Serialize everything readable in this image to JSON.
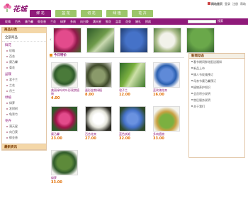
{
  "brand": {
    "logo_text": "花城",
    "accent": "#8f1a7a",
    "tab_green": "#9cc66a",
    "price_color": "#e06c00"
  },
  "top_links": [
    "网站首页",
    "登录",
    "注册",
    "帮助"
  ],
  "tabs": [
    {
      "label": "鲜 花"
    },
    {
      "label": "盆 花"
    },
    {
      "label": "切 花"
    },
    {
      "label": "绿 植"
    },
    {
      "label": "花 卉"
    }
  ],
  "nav": [
    "玫瑰",
    "百合",
    "康乃馨",
    "郁金香",
    "兰花",
    "绿萝",
    "多肉",
    "向日葵",
    "满天星",
    "鲜花",
    "盆栽",
    "花束",
    "婚礼",
    "探病"
  ],
  "search": {
    "button": "搜索"
  },
  "sidebar": {
    "title": "商品分类",
    "all": "全部商品",
    "groups": [
      {
        "name": "鲜花",
        "items": [
          "玫瑰",
          "百合",
          "康乃馨",
          "菊花"
        ]
      },
      {
        "name": "盆栽",
        "items": [
          "君子兰",
          "兰花",
          "吊兰"
        ]
      },
      {
        "name": "绿植",
        "items": [
          "绿萝",
          "发财树",
          "龟背竹"
        ]
      },
      {
        "name": "花卉",
        "items": [
          "满天星",
          "向日葵",
          "郁金香"
        ]
      }
    ],
    "bottom_title": "最新资讯"
  },
  "section": {
    "title": "今日特价"
  },
  "products": [
    {
      "name": "美丽绿叶的叶形观赏植物",
      "price": "4.00",
      "color": "#2f5a2a"
    },
    {
      "name": "蛋形盆栽绿植",
      "price": "8.00",
      "color": "#6c7a4a"
    },
    {
      "name": "君子兰",
      "price": "12.00",
      "color": "#4e9a2a"
    },
    {
      "name": "蓝玫瑰花束",
      "price": "16.00",
      "color": "#2a5fb0"
    },
    {
      "name": "康乃馨",
      "price": "23.00",
      "color": "#c21f5a"
    },
    {
      "name": "百合花束",
      "price": "27.00",
      "color": "#d8d8d0"
    },
    {
      "name": "蓝色妖姬",
      "price": "32.00",
      "color": "#4572c8"
    },
    {
      "name": "多肉植物",
      "price": "33.00",
      "color": "#7bb040"
    },
    {
      "name": "绿萝",
      "price": "33.00",
      "color": "#5d8a3a"
    }
  ],
  "news": {
    "title": "新闻动态",
    "items": [
      "春节期间鲜花配送通知",
      "新品上市",
      "情人节玫瑰预订",
      "母亲节康乃馨预订",
      "植物养护知识",
      "会员积分说明",
      "售后服务说明",
      "关于我们"
    ]
  }
}
